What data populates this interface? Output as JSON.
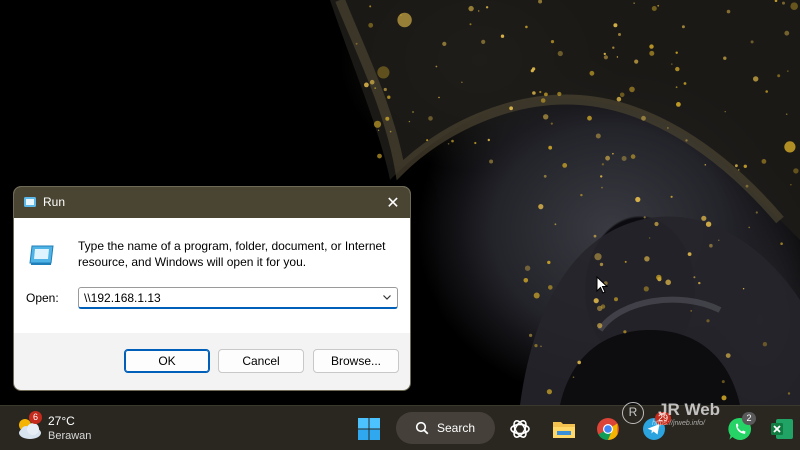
{
  "run_dialog": {
    "title": "Run",
    "close_glyph": "✕",
    "description": "Type the name of a program, folder, document, or Internet resource, and Windows will open it for you.",
    "open_label": "Open:",
    "open_value": "\\\\192.168.1.13",
    "ok_label": "OK",
    "cancel_label": "Cancel",
    "browse_label": "Browse..."
  },
  "taskbar": {
    "weather": {
      "badge": "6",
      "temperature": "27°C",
      "condition": "Berawan",
      "icon": "cloud-sun-icon"
    },
    "search_label": "Search",
    "pinned": [
      {
        "name": "start-button",
        "icon": "windows-logo-icon"
      },
      {
        "name": "chatgpt-app",
        "icon": "openai-icon"
      },
      {
        "name": "file-explorer-app",
        "icon": "folder-icon"
      },
      {
        "name": "chrome-app",
        "icon": "chrome-icon"
      },
      {
        "name": "telegram-app",
        "icon": "telegram-icon",
        "badge": "29"
      },
      {
        "name": "whatsapp-app",
        "icon": "whatsapp-icon",
        "badge": "2"
      },
      {
        "name": "excel-app",
        "icon": "excel-icon"
      }
    ]
  },
  "watermark": {
    "logo_letter": "R",
    "title": "JR Web",
    "url": "https://jrweb.info/"
  },
  "colors": {
    "titlebar": "#4a4532",
    "taskbar": "#2a2720",
    "accent": "#005fb8",
    "wallpaper_gold": "#c9a227"
  }
}
